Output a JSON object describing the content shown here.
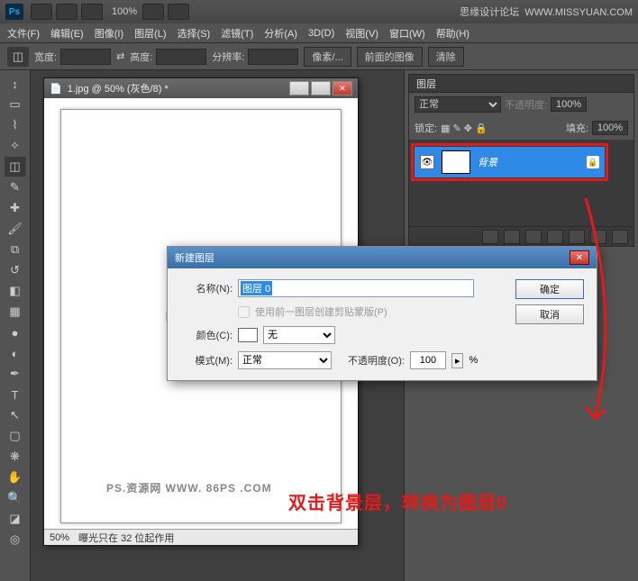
{
  "titlebar": {
    "zoom": "100%",
    "site_label": "思缘设计论坛",
    "site_url": "WWW.MISSYUAN.COM"
  },
  "menu": {
    "file": "文件(F)",
    "edit": "编辑(E)",
    "image": "图像(I)",
    "layer": "图层(L)",
    "select": "选择(S)",
    "filter": "滤镜(T)",
    "analysis": "分析(A)",
    "three_d": "3D(D)",
    "view": "视图(V)",
    "window": "窗口(W)",
    "help": "帮助(H)"
  },
  "options": {
    "width": "宽度:",
    "height": "高度:",
    "resolution": "分辨率:",
    "pixels": "像素/...",
    "front_image": "前面的图像",
    "clear": "清除"
  },
  "document": {
    "title": "1.jpg @ 50% (灰色/8) *",
    "zoom": "50%",
    "status": "曝光只在 32 位起作用",
    "watermark": "PS.资源网  WWW. 86PS .COM"
  },
  "layers_panel": {
    "tab": "图层",
    "blend": "正常",
    "opacity_label": "不透明度:",
    "opacity": "100%",
    "lock_label": "锁定:",
    "fill_label": "填充:",
    "fill": "100%",
    "bg_layer": "背景"
  },
  "dialog": {
    "title": "新建图层",
    "name_label": "名称(N):",
    "name_value": "图层 0",
    "clipmask": "使用前一图层创建剪贴蒙版(P)",
    "color_label": "颜色(C):",
    "color_value": "无",
    "mode_label": "模式(M):",
    "mode_value": "正常",
    "opacity_label": "不透明度(O):",
    "opacity_value": "100",
    "opacity_unit": "%",
    "ok": "确定",
    "cancel": "取消"
  },
  "annotation": "双击背景层，转换为图层0"
}
